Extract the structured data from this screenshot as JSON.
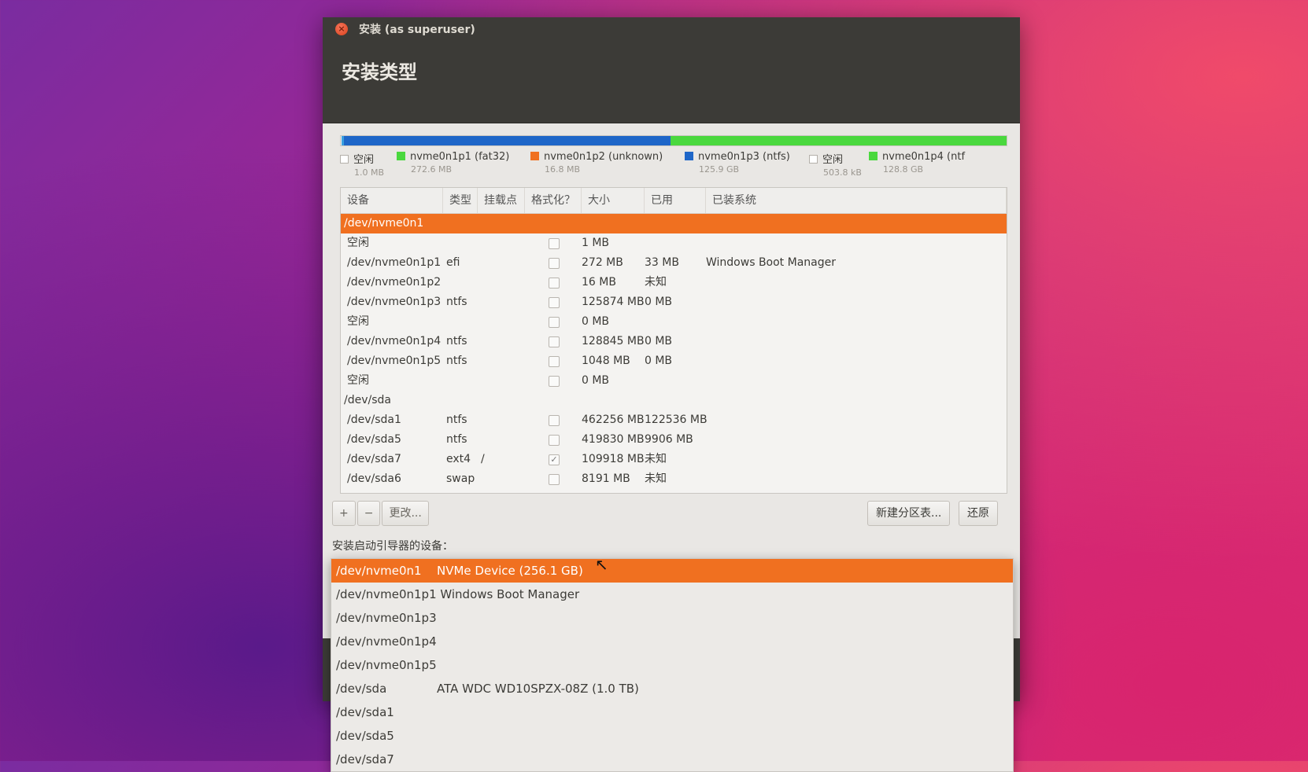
{
  "window": {
    "title": "安装 (as superuser)",
    "heading": "安装类型"
  },
  "partition_bar": [
    {
      "color": "#f0f0ee",
      "fraction": 0.001
    },
    {
      "color": "#3aa0e0",
      "fraction": 0.004
    },
    {
      "color": "#1e66c8",
      "fraction": 0.49
    },
    {
      "color": "#4ad83e",
      "fraction": 0.505
    }
  ],
  "legend": [
    {
      "label": "空闲",
      "size": "1.0 MB",
      "color": "empty"
    },
    {
      "label": "nvme0n1p1 (fat32)",
      "size": "272.6 MB",
      "color": "#4ad83e"
    },
    {
      "label": "nvme0n1p2 (unknown)",
      "size": "16.8 MB",
      "color": "#f07020"
    },
    {
      "label": "nvme0n1p3 (ntfs)",
      "size": "125.9 GB",
      "color": "#1e66c8"
    },
    {
      "label": "空闲",
      "size": "503.8 kB",
      "color": "empty"
    },
    {
      "label": "nvme0n1p4 (ntf",
      "size": "128.8 GB",
      "color": "#4ad83e"
    }
  ],
  "table": {
    "headers": [
      "设备",
      "类型",
      "挂载点",
      "格式化？",
      "大小",
      "已用",
      "已装系统"
    ],
    "rows": [
      {
        "device": "/dev/nvme0n1",
        "indent": false,
        "type": "",
        "mount": "",
        "format": null,
        "size": "",
        "used": "",
        "system": "",
        "selected": true
      },
      {
        "device": "空闲",
        "indent": true,
        "type": "",
        "mount": "",
        "format": false,
        "size": "1 MB",
        "used": "",
        "system": ""
      },
      {
        "device": "/dev/nvme0n1p1",
        "indent": true,
        "type": "efi",
        "mount": "",
        "format": false,
        "size": "272 MB",
        "used": "33 MB",
        "system": "Windows Boot Manager"
      },
      {
        "device": "/dev/nvme0n1p2",
        "indent": true,
        "type": "",
        "mount": "",
        "format": false,
        "size": "16 MB",
        "used": "未知",
        "system": ""
      },
      {
        "device": "/dev/nvme0n1p3",
        "indent": true,
        "type": "ntfs",
        "mount": "",
        "format": false,
        "size": "125874 MB",
        "used": "0 MB",
        "system": ""
      },
      {
        "device": "空闲",
        "indent": true,
        "type": "",
        "mount": "",
        "format": false,
        "size": "0 MB",
        "used": "",
        "system": ""
      },
      {
        "device": "/dev/nvme0n1p4",
        "indent": true,
        "type": "ntfs",
        "mount": "",
        "format": false,
        "size": "128845 MB",
        "used": "0 MB",
        "system": ""
      },
      {
        "device": "/dev/nvme0n1p5",
        "indent": true,
        "type": "ntfs",
        "mount": "",
        "format": false,
        "size": "1048 MB",
        "used": "0 MB",
        "system": ""
      },
      {
        "device": "空闲",
        "indent": true,
        "type": "",
        "mount": "",
        "format": false,
        "size": "0 MB",
        "used": "",
        "system": ""
      },
      {
        "device": "/dev/sda",
        "indent": false,
        "type": "",
        "mount": "",
        "format": null,
        "size": "",
        "used": "",
        "system": ""
      },
      {
        "device": "/dev/sda1",
        "indent": true,
        "type": "ntfs",
        "mount": "",
        "format": false,
        "size": "462256 MB",
        "used": "122536 MB",
        "system": ""
      },
      {
        "device": "/dev/sda5",
        "indent": true,
        "type": "ntfs",
        "mount": "",
        "format": false,
        "size": "419830 MB",
        "used": "9906 MB",
        "system": ""
      },
      {
        "device": "/dev/sda7",
        "indent": true,
        "type": "ext4",
        "mount": "/",
        "format": true,
        "size": "109918 MB",
        "used": "未知",
        "system": ""
      },
      {
        "device": "/dev/sda6",
        "indent": true,
        "type": "swap",
        "mount": "",
        "format": false,
        "size": "8191 MB",
        "used": "未知",
        "system": ""
      }
    ]
  },
  "toolbar": {
    "add": "+",
    "remove": "−",
    "change": "更改...",
    "new_table": "新建分区表...",
    "revert": "还原"
  },
  "boot_label": "安装启动引导器的设备：",
  "boot_devices": [
    {
      "device": "/dev/nvme0n1",
      "desc": "NVMe Device (256.1 GB)",
      "selected": true
    },
    {
      "device": "/dev/nvme0n1p1 Windows Boot Manager",
      "desc": ""
    },
    {
      "device": "/dev/nvme0n1p3",
      "desc": ""
    },
    {
      "device": "/dev/nvme0n1p4",
      "desc": ""
    },
    {
      "device": "/dev/nvme0n1p5",
      "desc": ""
    },
    {
      "device": "/dev/sda",
      "desc": "ATA WDC WD10SPZX-08Z (1.0 TB)"
    },
    {
      "device": "/dev/sda1",
      "desc": ""
    },
    {
      "device": "/dev/sda5",
      "desc": ""
    },
    {
      "device": "/dev/sda7",
      "desc": ""
    }
  ]
}
